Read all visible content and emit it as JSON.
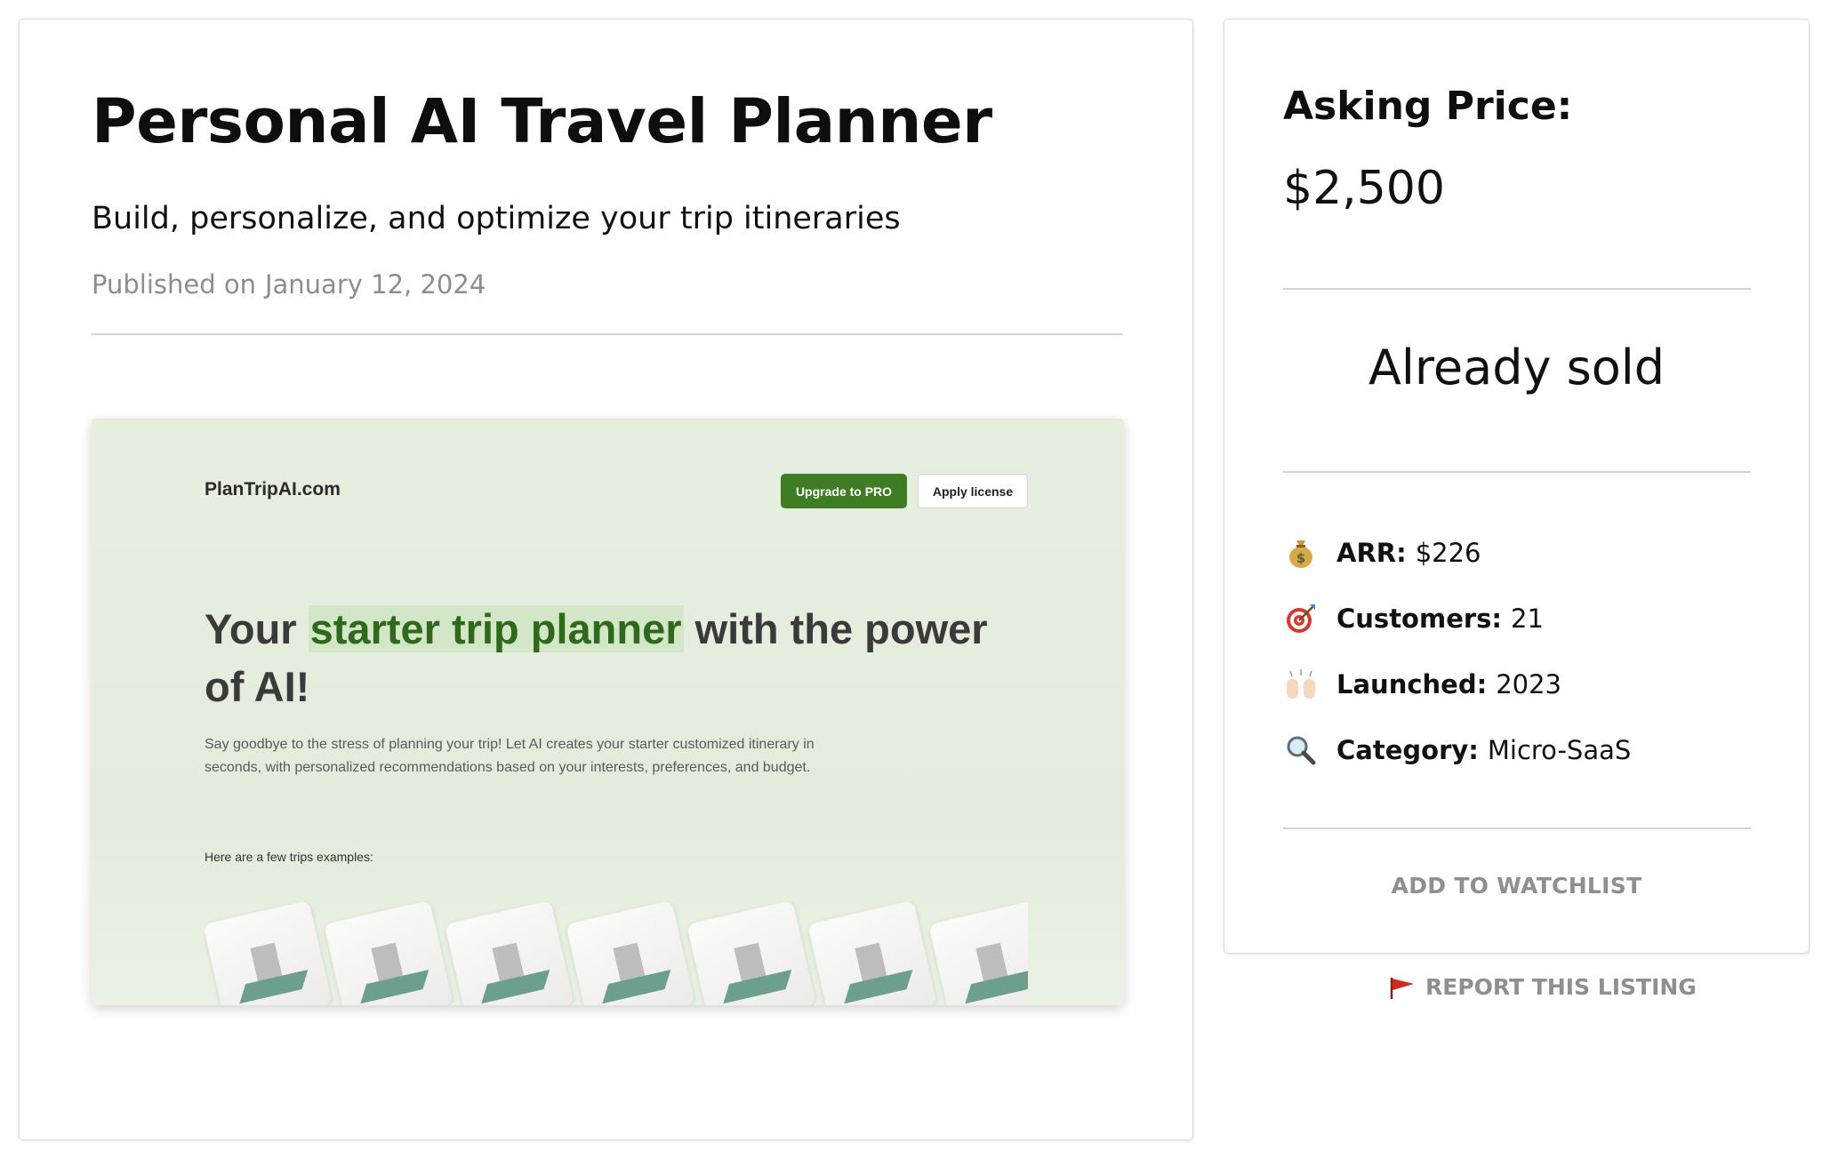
{
  "listing": {
    "title": "Personal AI Travel Planner",
    "subtitle": "Build, personalize, and optimize your trip itineraries",
    "published_prefix": "Published on",
    "published_date": "January 12, 2024"
  },
  "preview": {
    "logo": "PlanTripAI.com",
    "upgrade_button": "Upgrade to PRO",
    "license_button": "Apply license",
    "hero_before": "Your ",
    "hero_highlight": "starter trip planner",
    "hero_after": " with the power of AI!",
    "description": "Say goodbye to the stress of planning your trip! Let AI creates your starter customized itinerary in seconds, with personalized recommendations based on your interests, preferences, and budget.",
    "trips_label": "Here are a few trips examples:",
    "trip_cards": 7
  },
  "sidebar": {
    "asking_label": "Asking Price:",
    "asking_value": "$2,500",
    "status": "Already sold",
    "stats": [
      {
        "icon": "money-bag-icon",
        "label": "ARR:",
        "value": "$226"
      },
      {
        "icon": "target-icon",
        "label": "Customers:",
        "value": "21"
      },
      {
        "icon": "raised-hands-icon",
        "label": "Launched:",
        "value": "2023"
      },
      {
        "icon": "magnifier-icon",
        "label": "Category:",
        "value": "Micro-SaaS"
      }
    ],
    "watchlist": "ADD TO WATCHLIST"
  },
  "report": {
    "label": "REPORT THIS LISTING",
    "icon": "red-flag-icon"
  },
  "colors": {
    "accent_green": "#3f7d24",
    "highlight_text": "#2f6a1c",
    "muted_gray": "#8f8f8f",
    "flag_red": "#cc2a1f"
  }
}
